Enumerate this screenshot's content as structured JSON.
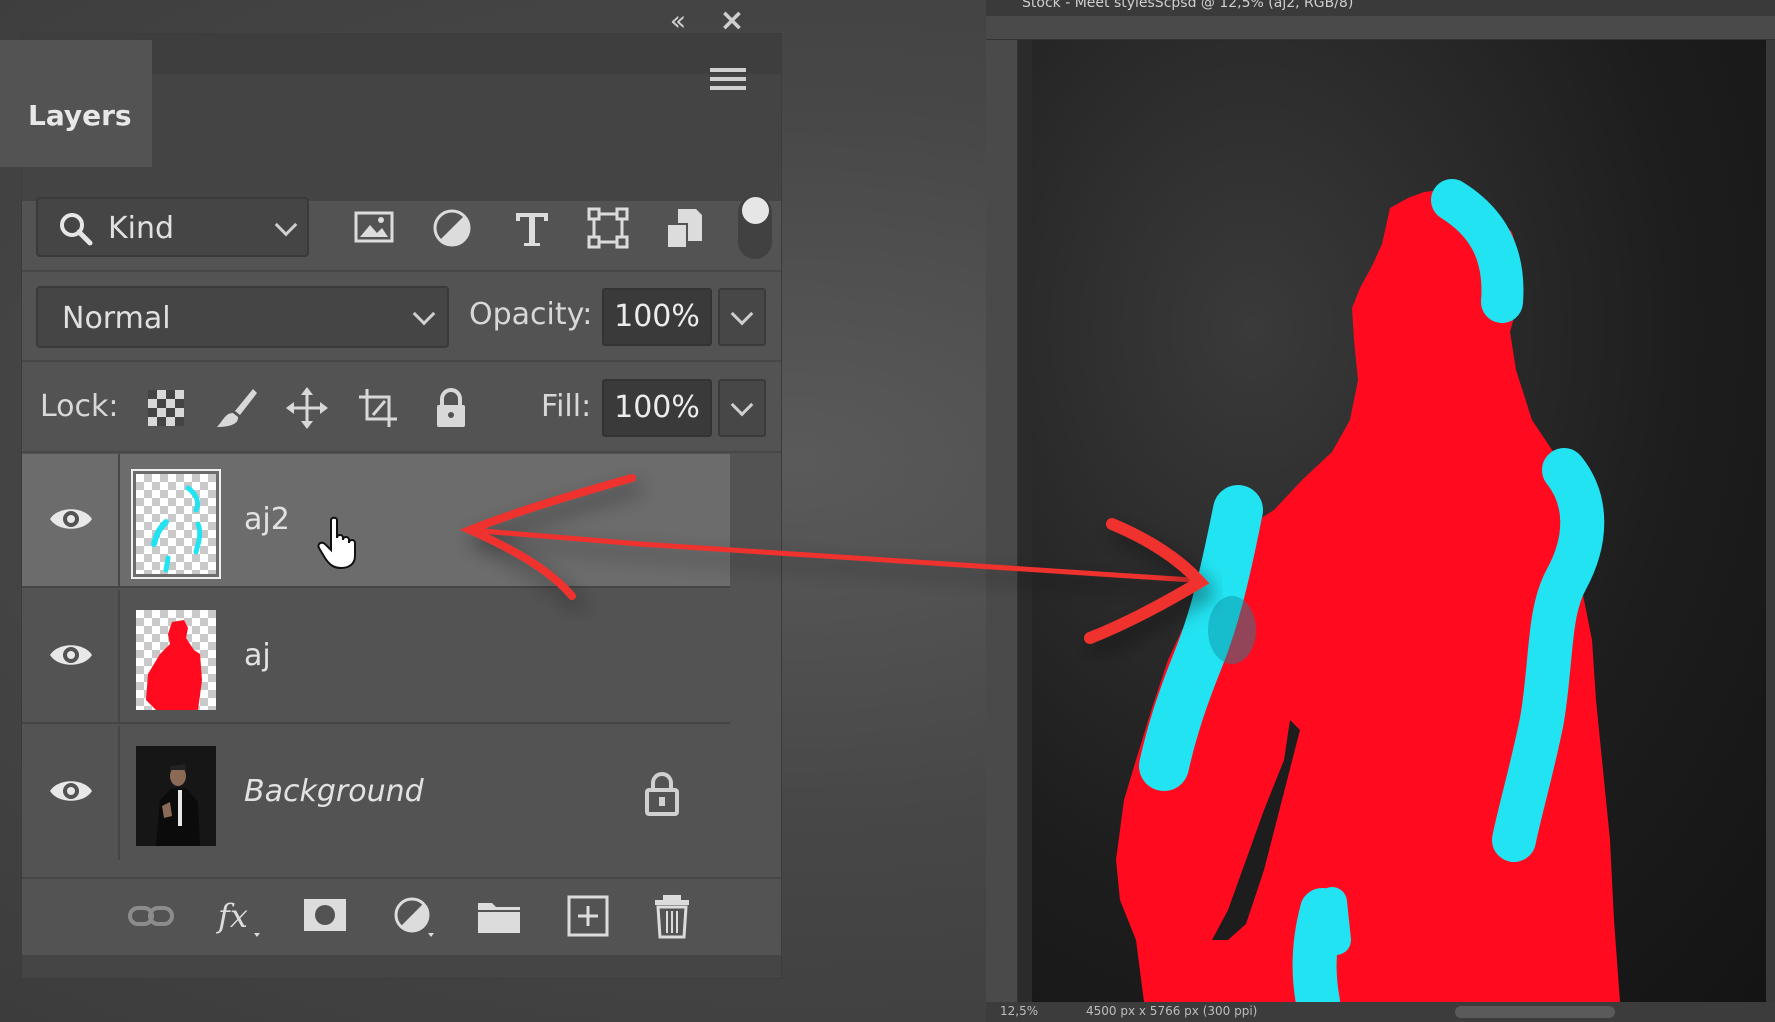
{
  "layers_panel": {
    "tab_label": "Layers",
    "filter": {
      "kind_label": "Kind"
    },
    "blend_mode": "Normal",
    "opacity_label": "Opacity:",
    "opacity_value": "100%",
    "lock_label": "Lock:",
    "fill_label": "Fill:",
    "fill_value": "100%",
    "layers": [
      {
        "name": "aj2",
        "visible": true,
        "selected": true
      },
      {
        "name": "aj",
        "visible": true,
        "selected": false
      },
      {
        "name": "Background",
        "visible": true,
        "selected": false,
        "locked": true
      }
    ]
  },
  "document": {
    "title": "Stock - Meet stylesScpsd @ 12,5% (aj2, RGB/8)",
    "zoom": "12,5%",
    "dimensions": "4500 px x 5766 px (300 ppi)"
  },
  "colors": {
    "panel_bg": "#535353",
    "selected_row": "#6c6c6c",
    "mask_red": "#ff0a1e",
    "mask_cyan": "#22e3f2",
    "arrow_red": "#f0302e"
  }
}
